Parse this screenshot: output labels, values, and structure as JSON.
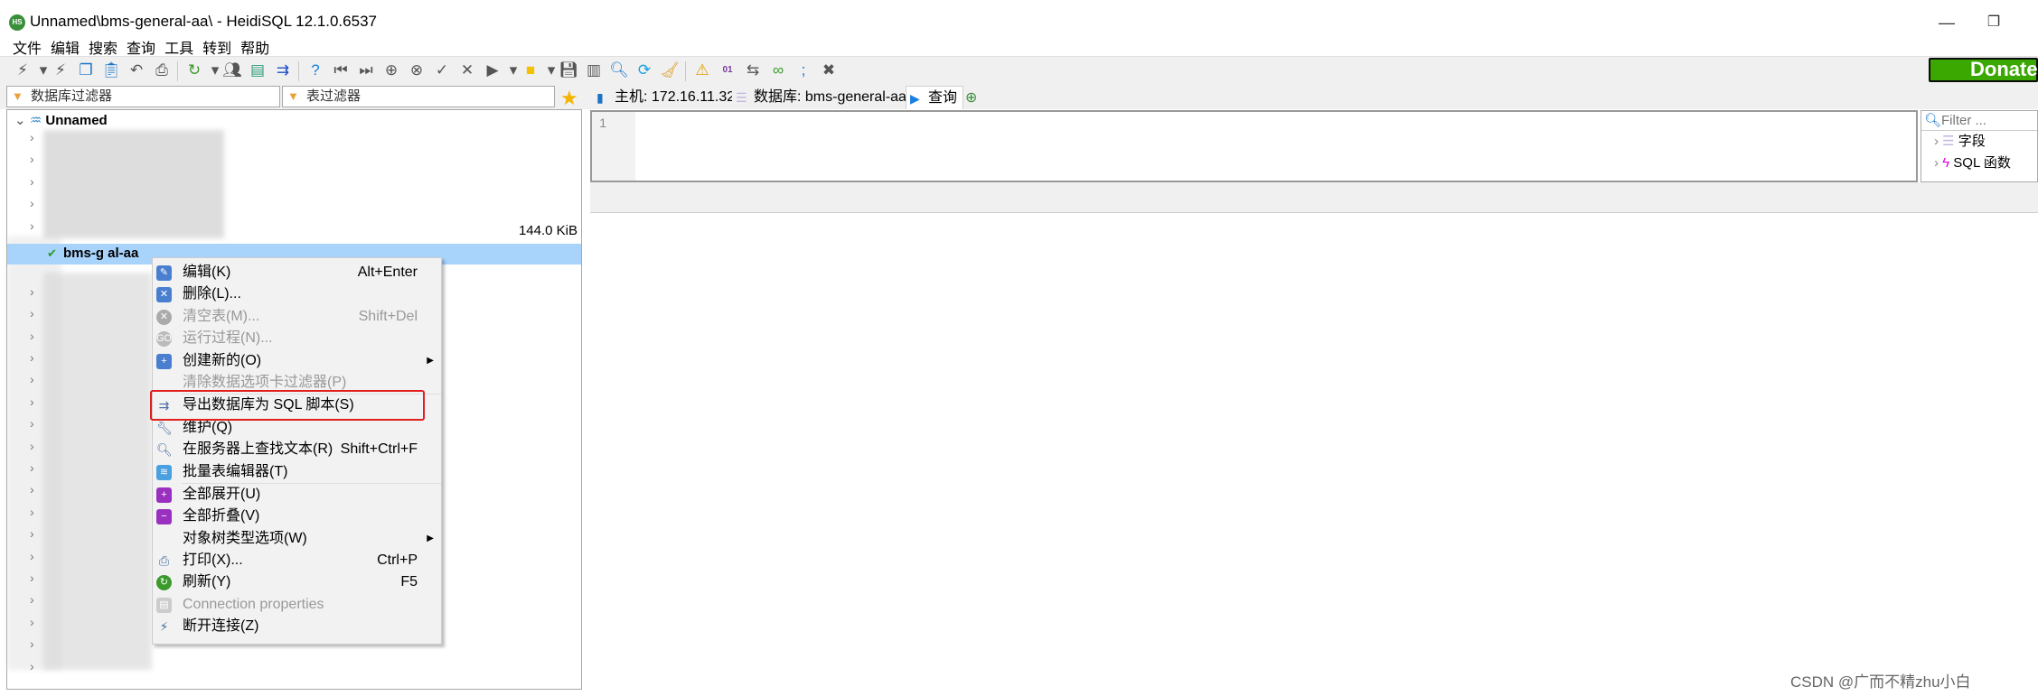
{
  "window": {
    "title": "Unnamed\\bms-general-aa\\ - HeidiSQL 12.1.0.6537",
    "app_icon": "HS",
    "minimize": "—",
    "restore": "❐"
  },
  "menu": [
    "文件",
    "编辑",
    "搜索",
    "查询",
    "工具",
    "转到",
    "帮助"
  ],
  "toolbar": {
    "icons": [
      "connect-icon",
      "dropdown-icon",
      "disconnect-icon",
      "copy-icon",
      "paste-icon",
      "undo-icon",
      "print-icon",
      "refresh-icon",
      "dropdown-icon",
      "user-manager-icon",
      "csv-export-icon",
      "export-sql-icon",
      "help-icon",
      "first-icon",
      "last-icon",
      "add-icon",
      "cancel-icon",
      "check-icon",
      "delete-icon",
      "run-icon",
      "dropdown-icon",
      "folder-icon",
      "dropdown-icon",
      "save-icon",
      "save-as-icon",
      "find-icon",
      "replace-icon",
      "clean-icon",
      "warning-icon",
      "binary-icon",
      "wrap-icon",
      "link-icon",
      "semicolon-icon",
      "close-tab-icon"
    ],
    "donate": "Donate"
  },
  "filters": {
    "database": "数据库过滤器",
    "table": "表过滤器"
  },
  "tabs": [
    {
      "label": "主机: 172.16.11.32"
    },
    {
      "label": "数据库: bms-general-aa"
    },
    {
      "label": "查询"
    }
  ],
  "tree": {
    "root": "Unnamed",
    "size": "144.0 KiB",
    "selected": "bms-g     al-aa"
  },
  "editor": {
    "line": "1"
  },
  "helpers": {
    "filter_placeholder": "Filter ...",
    "items": [
      "字段",
      "SQL 函数"
    ]
  },
  "context_menu": [
    {
      "label": "编辑(K)",
      "shortcut": "Alt+Enter"
    },
    {
      "label": "删除(L)...",
      "shortcut": ""
    },
    {
      "label": "清空表(M)...",
      "shortcut": "Shift+Del",
      "disabled": true
    },
    {
      "label": "运行过程(N)...",
      "shortcut": "",
      "disabled": true
    },
    {
      "label": "创建新的(O)",
      "submenu": true
    },
    {
      "label": "清除数据选项卡过滤器(P)",
      "disabled": true
    },
    {
      "label": "导出数据库为 SQL 脚本(S)",
      "highlighted": true
    },
    {
      "label": "维护(Q)"
    },
    {
      "label": "在服务器上查找文本(R)",
      "shortcut": "Shift+Ctrl+F"
    },
    {
      "label": "批量表编辑器(T)"
    },
    {
      "label": "全部展开(U)"
    },
    {
      "label": "全部折叠(V)"
    },
    {
      "label": "对象树类型选项(W)",
      "submenu": true
    },
    {
      "label": "打印(X)...",
      "shortcut": "Ctrl+P"
    },
    {
      "label": "刷新(Y)",
      "shortcut": "F5"
    },
    {
      "label": "Connection properties",
      "disabled": true
    },
    {
      "label": "断开连接(Z)"
    }
  ],
  "watermark": "CSDN @广而不精zhu小白",
  "colors": {
    "selection": "#a8d3fb",
    "highlight_box": "#e0201e",
    "donate": "#3aa800"
  }
}
